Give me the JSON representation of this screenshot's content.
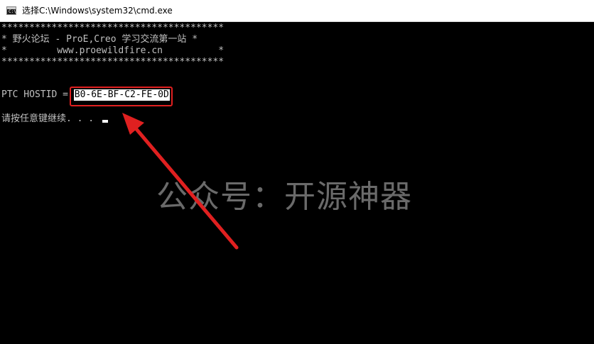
{
  "window": {
    "title": "选择C:\\Windows\\system32\\cmd.exe",
    "icon": "cmd-icon"
  },
  "console": {
    "lines": [
      "****************************************",
      "* 野火论坛 - ProE,Creo 学习交流第一站 *",
      "*         www.proewildfire.cn          *",
      "****************************************"
    ],
    "hostid_label": "PTC HOSTID = ",
    "hostid_value": "B0-6E-BF-C2-FE-0D",
    "prompt": "请按任意键继续. . . "
  },
  "overlay": {
    "watermark": "公众号：开源神器",
    "highlight_color": "#e02020"
  }
}
